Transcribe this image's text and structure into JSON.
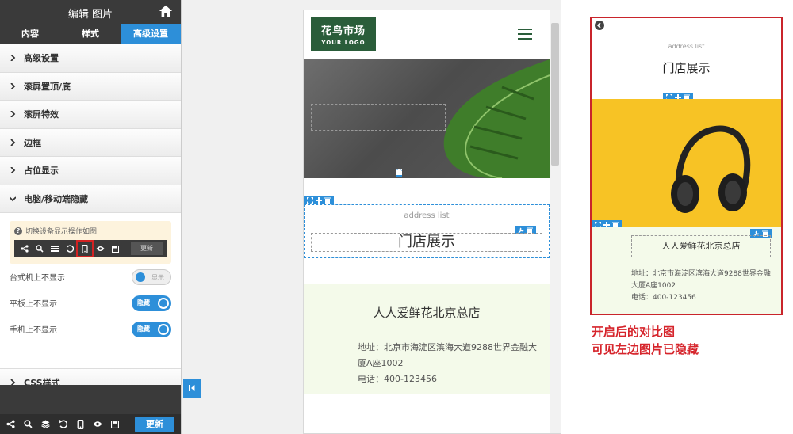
{
  "panel": {
    "title": "编辑 图片",
    "tabs": [
      {
        "label": "内容",
        "active": false
      },
      {
        "label": "样式",
        "active": false
      },
      {
        "label": "高级设置",
        "active": true
      }
    ],
    "sections_top": [
      {
        "label": "高级设置"
      },
      {
        "label": "滚屏置顶/底"
      },
      {
        "label": "滚屏特效"
      },
      {
        "label": "边框"
      },
      {
        "label": "占位显示"
      }
    ],
    "expanded_section": {
      "label": "电脑/移动端隐藏",
      "tip": "切换设备显示操作如图",
      "mini_update": "更新",
      "toggles": [
        {
          "label": "台式机上不显示",
          "state": "显示"
        },
        {
          "label": "平板上不显示",
          "state": "隐藏"
        },
        {
          "label": "手机上不显示",
          "state": "隐藏"
        }
      ]
    },
    "css_section": {
      "label": "CSS样式"
    },
    "bottom_update": "更新",
    "accent_color": "#2d8fd9"
  },
  "preview": {
    "logo_cn": "花鸟市场",
    "logo_en": "YOUR LOGO",
    "address_label": "address list",
    "store_title": "门店展示",
    "store_name": "人人爱鲜花北京总店",
    "address_line": "地址：北京市海淀区滨海大道9288世界金融大厦A座1002",
    "phone_line": "电话：400-123456"
  },
  "compare": {
    "address_label": "address list",
    "title": "门店展示",
    "store_name": "人人爱鲜花北京总店",
    "address_line": "地址：北京市海淀区滨海大道9288世界金融大厦A座1002",
    "phone_line": "电话：400-123456",
    "caption_line1": "开启后的对比图",
    "caption_line2": "可见左边图片已隐藏",
    "border_color": "#c9242b"
  }
}
